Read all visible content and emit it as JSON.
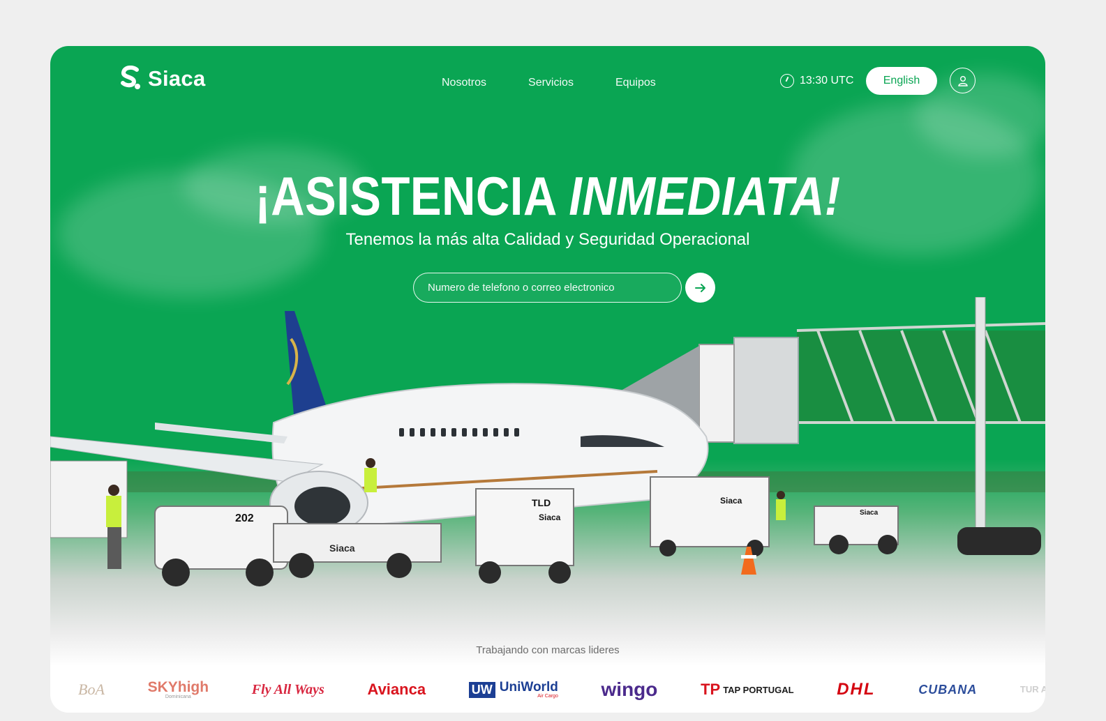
{
  "header": {
    "logo_text": "Siaca",
    "nav": [
      "Nosotros",
      "Servicios",
      "Equipos"
    ],
    "time": "13:30 UTC",
    "language_button": "English"
  },
  "hero": {
    "title_main": "¡ASISTENCIA ",
    "title_italic": "INMEDIATA!",
    "subtitle": "Tenemos la más alta Calidad y Seguridad Operacional",
    "search_placeholder": "Numero de telefono o correo electronico"
  },
  "scene": {
    "vehicle_labels": [
      "202",
      "TLD",
      "Siaca",
      "Siaca",
      "Siaca",
      "Siaca",
      "TLD"
    ]
  },
  "brands": {
    "label": "Trabajando con marcas lideres",
    "items": [
      {
        "name": "BoA",
        "color": "#c9b7a4"
      },
      {
        "name": "SKYhigh",
        "sub": "Dominicana",
        "color": "#e07a6a"
      },
      {
        "name": "Fly All Ways",
        "color": "#d8263f"
      },
      {
        "name": "Avianca",
        "color": "#d9141e"
      },
      {
        "name": "UniWorld",
        "mark": "UW",
        "sub": "Air Cargo",
        "color": "#1c3f94"
      },
      {
        "name": "wingo",
        "color": "#4b2a8c"
      },
      {
        "name": "TAP PORTUGAL",
        "mark": "TP",
        "color": "#1a1a1a"
      },
      {
        "name": "DHL",
        "color": "#d40511"
      },
      {
        "name": "CUBANA",
        "color": "#2c4d9b"
      },
      {
        "name": "TUR AIRL",
        "color": "#cfcfcf"
      }
    ]
  },
  "colors": {
    "brand_green": "#0aa553",
    "white": "#ffffff"
  }
}
